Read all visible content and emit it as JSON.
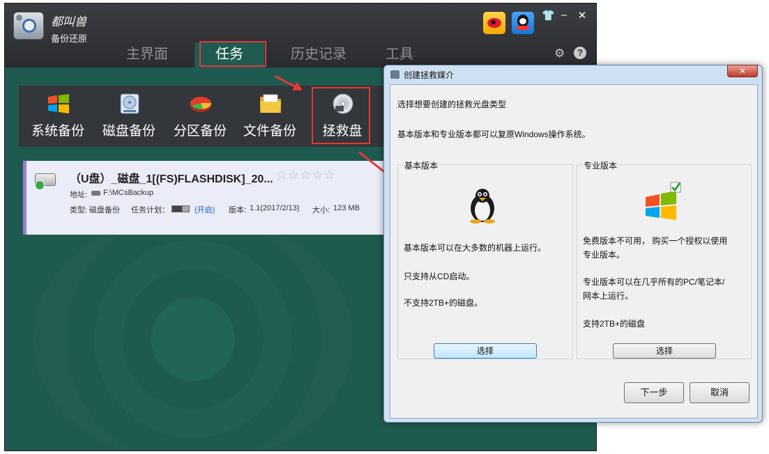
{
  "app": {
    "brand_line1": "都叫兽",
    "brand_line2": "备份还原",
    "window_controls": {
      "skin": "👕",
      "minimize": "–",
      "close": "✕"
    },
    "nav_tabs": [
      "主界面",
      "任务",
      "历史记录",
      "工具"
    ],
    "active_tab": "任务",
    "header_icons": [
      "weibo-icon",
      "qq-icon",
      "settings-icon",
      "help-icon"
    ],
    "help_glyph": "?",
    "settings_glyph": "⚙"
  },
  "toolbar": {
    "items": [
      {
        "label": "系统备份",
        "icon": "windows-logo-icon"
      },
      {
        "label": "磁盘备份",
        "icon": "hard-disk-icon"
      },
      {
        "label": "分区备份",
        "icon": "pie-partition-icon"
      },
      {
        "label": "文件备份",
        "icon": "folder-icon"
      },
      {
        "label": "拯救盘",
        "icon": "cd-rescue-icon"
      }
    ]
  },
  "task": {
    "title": "（U盘）_磁盘_1[(FS)FLASHDISK]_20...",
    "stars": "☆☆☆☆☆",
    "addr_label": "地址:",
    "addr_value": "F:\\MCsBackup",
    "type_label": "类型:",
    "type_value": "磁盘备份",
    "plan_label": "任务计划：",
    "plan_state": "(开启)",
    "version_label": "版本:",
    "version_value": "1.1(2017/2/13)",
    "size_label": "大小:",
    "size_value": "123 MB"
  },
  "dialog": {
    "title": "创建拯救媒介",
    "close_glyph": "✕",
    "prompt": "选择想要创建的拯救光盘类型",
    "description": "基本版本和专业版本都可以复原Windows操作系统。",
    "basic": {
      "title": "基本版本",
      "lines": [
        "基本版本可以在大多数的机器上运行。",
        "只支持从CD启动。",
        "不支持2TB+的磁盘。"
      ],
      "button": "选择"
    },
    "pro": {
      "title": "专业版本",
      "lines": [
        "免费版本不可用， 购买一个授权以使用",
        "专业版本。",
        "专业版本可以在几乎所有的PC/笔记本/",
        "网本上运行。",
        "支持2TB+的磁盘"
      ],
      "button": "选择"
    },
    "next_button": "下一步",
    "cancel_button": "取消"
  },
  "colors": {
    "annotation_red": "#e53935",
    "content_teal": "#1f5a50",
    "task_accent": "#9a7fd1"
  }
}
